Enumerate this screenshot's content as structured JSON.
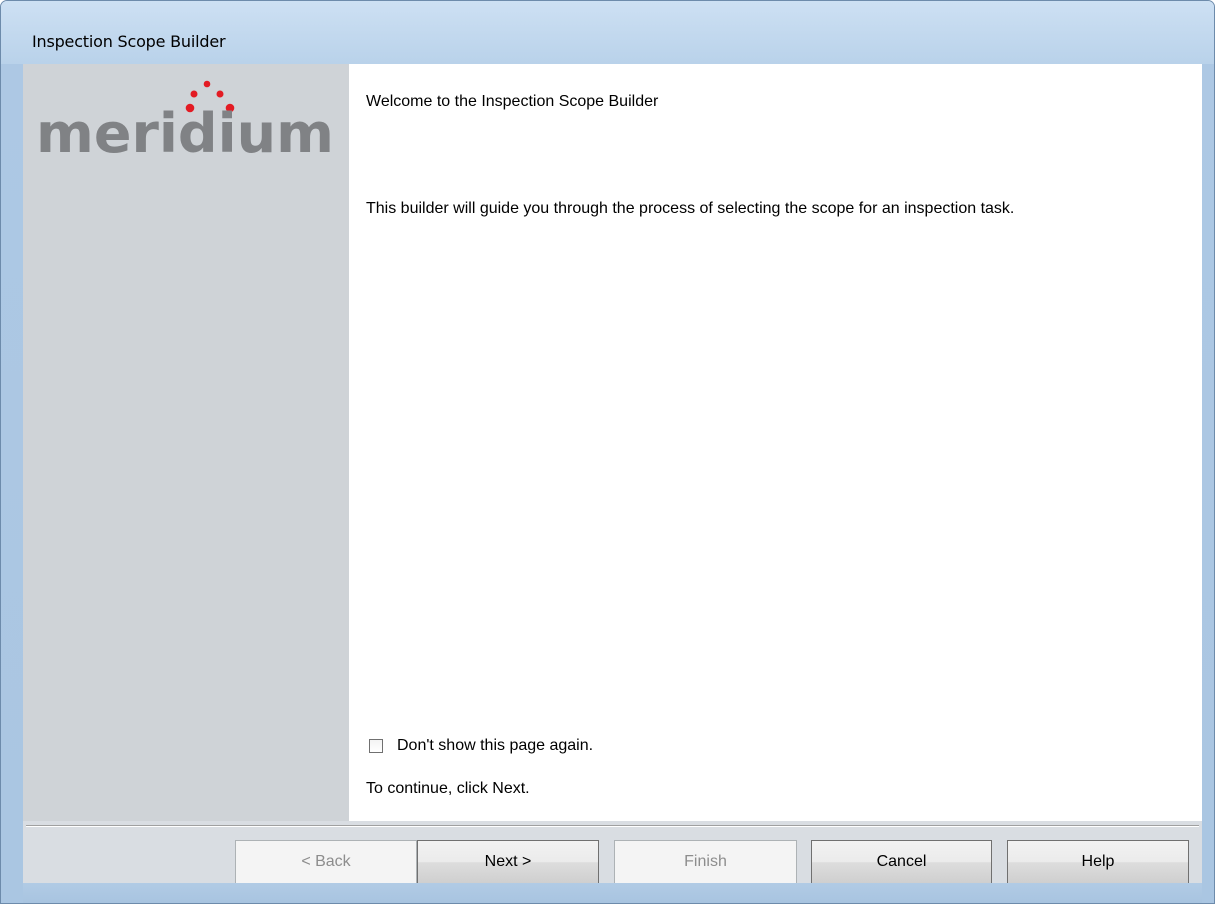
{
  "window": {
    "title": "Inspection Scope Builder"
  },
  "sidebar": {
    "logo_text": "meridium",
    "logo_colors": {
      "text": "#808285",
      "dots": "#e31b23"
    }
  },
  "content": {
    "welcome": "Welcome to the Inspection Scope Builder",
    "description": "This builder will guide you through the process of selecting the scope for an inspection task.",
    "dont_show_label": "Don't show this page again.",
    "dont_show_checked": false,
    "continue_text": "To continue, click Next."
  },
  "buttons": {
    "back": {
      "label": "< Back",
      "enabled": false
    },
    "next": {
      "label": "Next >",
      "enabled": true
    },
    "finish": {
      "label": "Finish",
      "enabled": false
    },
    "cancel": {
      "label": "Cancel",
      "enabled": true
    },
    "help": {
      "label": "Help",
      "enabled": true
    }
  },
  "colors": {
    "frame": "#b9d1ea",
    "sidebar": "#cfd3d7",
    "button_bar": "#d9dde2"
  }
}
